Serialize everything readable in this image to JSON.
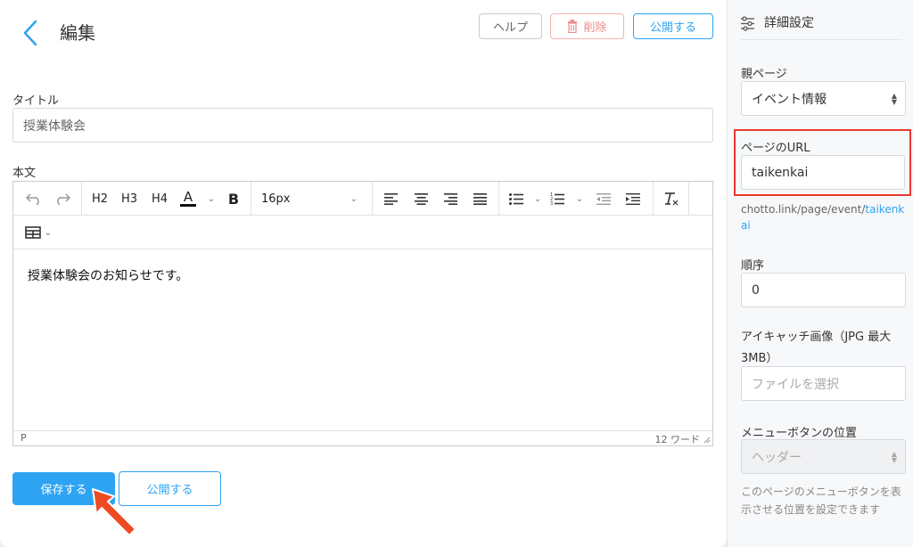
{
  "header": {
    "title": "編集",
    "help_label": "ヘルプ",
    "delete_label": "削除",
    "publish_label": "公開する"
  },
  "form": {
    "title_label": "タイトル",
    "title_value": "授業体験会",
    "body_label": "本文",
    "body_text": "授業体験会のお知らせです。"
  },
  "toolbar": {
    "h2": "H2",
    "h3": "H3",
    "h4": "H4",
    "text_color": "A",
    "bold": "B",
    "font_size": "16px"
  },
  "status": {
    "element": "P",
    "word_count": "12 ワード"
  },
  "actions": {
    "save_label": "保存する",
    "publish_label": "公開する"
  },
  "sidebar": {
    "title": "詳細設定",
    "parent_label": "親ページ",
    "parent_value": "イベント情報",
    "url_label": "ページのURL",
    "url_value": "taikenkai",
    "url_prefix": "chotto.link/page/event/",
    "url_slug": "taikenkai",
    "order_label": "順序",
    "order_value": "0",
    "eyecatch_label": "アイキャッチ画像（JPG 最大3MB）",
    "file_placeholder": "ファイルを選択",
    "menu_pos_label": "メニューボタンの位置",
    "menu_pos_value": "ヘッダー",
    "menu_pos_help": "このページのメニューボタンを表示させる位置を設定できます"
  },
  "colors": {
    "accent": "#2ea3f2",
    "danger": "#f08b8b",
    "highlight": "#e8392f"
  }
}
